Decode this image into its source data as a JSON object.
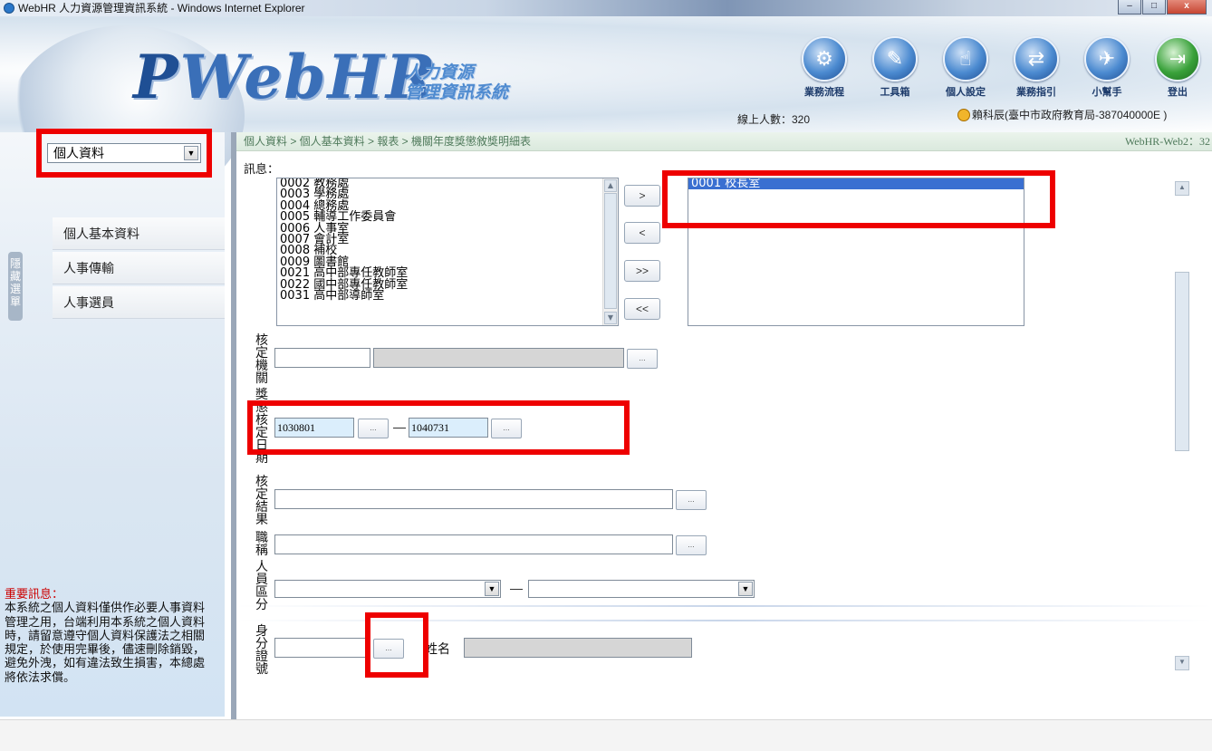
{
  "window": {
    "title": "WebHR 人力資源管理資訊系統 - Windows Internet Explorer",
    "min": "–",
    "max": "□",
    "close": "x"
  },
  "header": {
    "logo_letter": "P",
    "logo_text": "WebHR",
    "logo_sub_line1": "人力資源",
    "logo_sub_line2": "管理資訊系統",
    "toolbar": [
      {
        "label": "業務流程",
        "icon": "flowchart-icon"
      },
      {
        "label": "工具箱",
        "icon": "toolbox-icon"
      },
      {
        "label": "個人設定",
        "icon": "personal-settings-icon"
      },
      {
        "label": "業務指引",
        "icon": "guide-icon"
      },
      {
        "label": "小幫手",
        "icon": "helper-icon"
      },
      {
        "label": "登出",
        "icon": "logout-icon"
      }
    ],
    "online_users": "線上人數：320",
    "user_info": "賴科辰(臺中市政府教育局-387040000E )"
  },
  "sidebar": {
    "module_select": "個人資料",
    "hide_tab": "隱藏選單",
    "menu": [
      "個人基本資料",
      "人事傳輸",
      "人事選員"
    ],
    "notice_title": "重要訊息：",
    "notice_body": "本系統之個人資料僅供作必要人事資料管理之用，台端利用本系統之個人資料時，請留意遵守個人資料保護法之相關規定，於使用完畢後，儘速刪除銷毀，避免外洩，如有違法致生損害，本總處將依法求償。"
  },
  "main": {
    "breadcrumb": "個人資料 > 個人基本資料 > 報表 > 機關年度獎懲敘獎明細表",
    "server": "WebHR-Web2：32",
    "message_label": "訊息：",
    "available_units": [
      "0002 教務處",
      "0003 學務處",
      "0004 總務處",
      "0005 輔導工作委員會",
      "0006 人事室",
      "0007 會計室",
      "0008 補校",
      "0009 圖書館",
      "0021 高中部專任教師室",
      "0022 國中部專任教師室",
      "0031 高中部導師室"
    ],
    "selected_units": [
      "0001 校長室"
    ],
    "move_buttons": [
      ">",
      "<",
      ">>",
      "<<"
    ],
    "labels": {
      "agency": "核定機關",
      "date": "獎懲核定日期",
      "result": "核定結果",
      "title": "職稱",
      "category": "人員區分",
      "id_no": "身分證號",
      "name": "姓名"
    },
    "agency_code": "",
    "agency_name": "",
    "date_from": "1030801",
    "date_to": "1040731",
    "range_dash": "—",
    "dots_label": "...",
    "result_value": "",
    "title_value": "",
    "category_from": "",
    "category_to": "",
    "id_value": "",
    "name_value": "",
    "highlight_color": "#ee0000"
  }
}
